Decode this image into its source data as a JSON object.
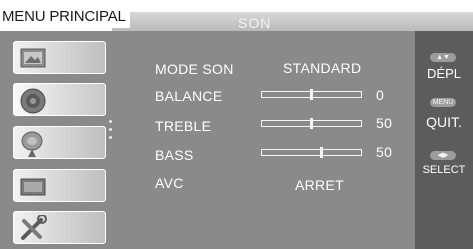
{
  "header": {
    "title": "MENU PRINCIPAL",
    "section": "SON"
  },
  "sidebar": {
    "items": [
      {
        "name": "picture",
        "icon": "picture-icon"
      },
      {
        "name": "sound",
        "icon": "speaker-icon",
        "active": true
      },
      {
        "name": "channel",
        "icon": "satellite-dish-icon"
      },
      {
        "name": "function",
        "icon": "tv-icon"
      },
      {
        "name": "setup",
        "icon": "tools-icon"
      }
    ]
  },
  "settings": {
    "mode_son": {
      "label": "MODE SON",
      "value": "STANDARD"
    },
    "balance": {
      "label": "BALANCE",
      "value": "0",
      "level": 0.5
    },
    "treble": {
      "label": "TREBLE",
      "value": "50",
      "level": 0.5
    },
    "bass": {
      "label": "BASS",
      "value": "50",
      "level": 0.6
    },
    "avc": {
      "label": "AVC",
      "value": "ARRET"
    }
  },
  "help": {
    "move": {
      "label": "DÉPL",
      "icon": "up-down-arrows-icon"
    },
    "quit": {
      "label": "QUIT.",
      "key": "MENU"
    },
    "select": {
      "label": "SELECT",
      "icon": "left-right-arrows-icon"
    }
  },
  "colors": {
    "panel": "#8a8a8a",
    "help_panel": "#5c5c5c",
    "text": "#ffffff"
  }
}
